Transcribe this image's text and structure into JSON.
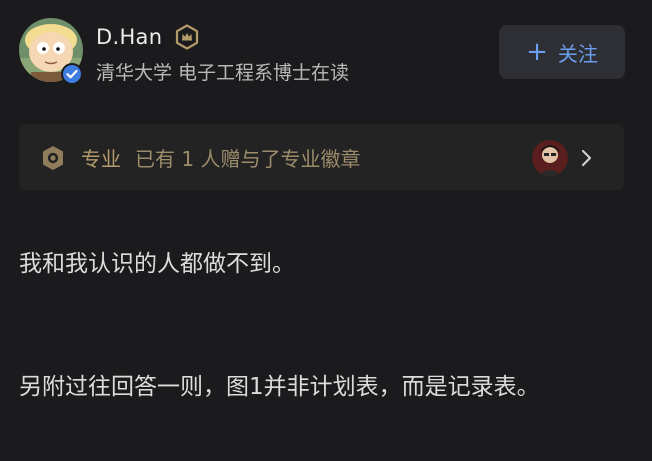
{
  "author": {
    "name": "D.Han",
    "bio": "清华大学 电子工程系博士在读",
    "verified": true
  },
  "follow_button": {
    "icon": "+",
    "label": "关注"
  },
  "award": {
    "category": "专业",
    "text": "已有 1 人赠与了专业徽章"
  },
  "content": {
    "paragraphs": [
      "我和我认识的人都做不到。",
      "另附过往回答一则，图1并非计划表，而是记录表。"
    ]
  },
  "colors": {
    "background": "#1b1b1d",
    "accent_blue": "#6d9ef0",
    "gold": "#b49b6c"
  }
}
